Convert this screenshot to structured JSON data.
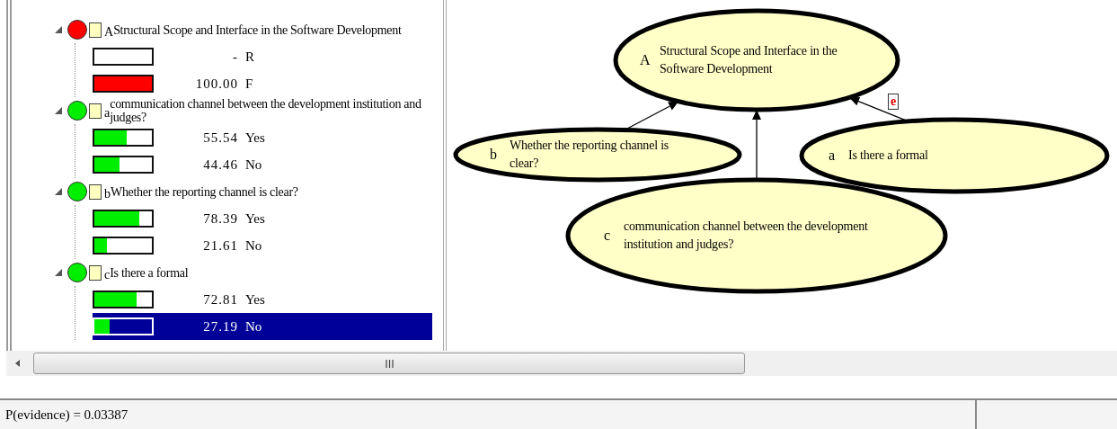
{
  "tree": {
    "nodes": [
      {
        "letter": "A",
        "title": "Structural Scope and Interface in the Software Development",
        "color": "#ff0000",
        "expanded": true,
        "states": [
          {
            "value": "-",
            "label": "R",
            "level": 0,
            "selected": false
          },
          {
            "value": "100.00",
            "label": "F",
            "level": 1,
            "selected": false
          }
        ]
      },
      {
        "letter": "a",
        "title": "communication channel between the development institution and judges?",
        "color": "#00ee00",
        "expanded": true,
        "states": [
          {
            "value": "55.54",
            "label": "Yes",
            "level": 0.5554,
            "selected": false
          },
          {
            "value": "44.46",
            "label": "No",
            "level": 0.4446,
            "selected": false
          }
        ]
      },
      {
        "letter": "b",
        "title": "Whether the reporting channel is clear?",
        "color": "#00ee00",
        "expanded": true,
        "states": [
          {
            "value": "78.39",
            "label": "Yes",
            "level": 0.7839,
            "selected": false
          },
          {
            "value": "21.61",
            "label": "No",
            "level": 0.2161,
            "selected": false
          }
        ]
      },
      {
        "letter": "c",
        "title": "Is there a formal",
        "color": "#00ee00",
        "expanded": true,
        "states": [
          {
            "value": "72.81",
            "label": "Yes",
            "level": 0.7281,
            "selected": false
          },
          {
            "value": "27.19",
            "label": "No",
            "level": 0.2719,
            "selected": true
          }
        ]
      }
    ]
  },
  "graph": {
    "nodes": [
      {
        "letter": "A",
        "text": "Structural Scope and Interface in the Software Development",
        "badge": "e"
      },
      {
        "letter": "b",
        "text": "Whether the reporting channel is clear?"
      },
      {
        "letter": "a",
        "text": "Is there a formal"
      },
      {
        "letter": "c",
        "text": "communication channel between the development institution and judges?"
      }
    ]
  },
  "status_bar": {
    "text": "P(evidence) = 0.03387"
  }
}
